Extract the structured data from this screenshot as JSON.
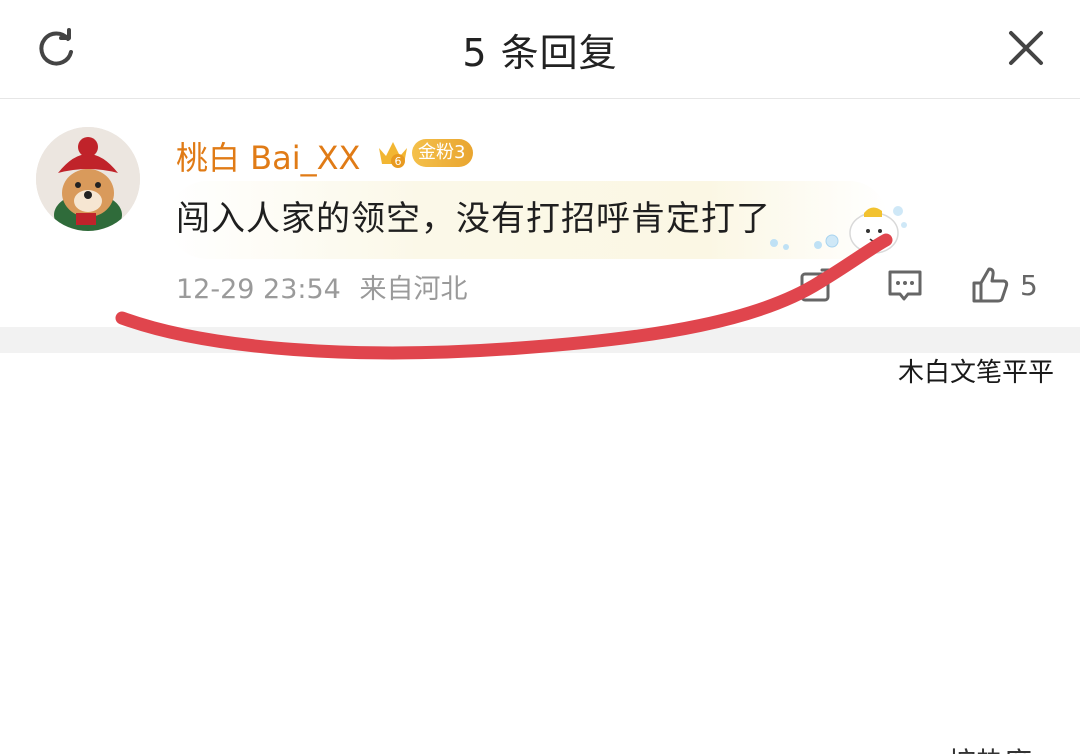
{
  "header": {
    "title": "5 条回复",
    "refresh_icon": "refresh-icon",
    "close_icon": "close-icon"
  },
  "comment": {
    "username": "桃白 Bai_XX",
    "badge_level": "6",
    "badge_label": "金粉3",
    "text": "闯入人家的领空，没有打招呼肯定打了",
    "time": "12-29 23:54",
    "location": "来自河北",
    "like_count": "5",
    "username_color": "#e07b16"
  },
  "overlay": {
    "watermark": "木白文笔平平",
    "annotation_color": "#e0454d"
  },
  "footer": {
    "partial_text": "按热度"
  }
}
